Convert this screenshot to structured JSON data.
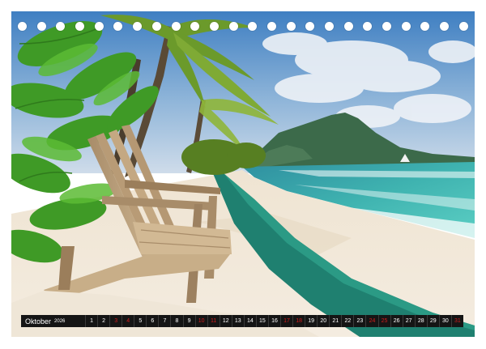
{
  "calendar": {
    "month": "Oktober",
    "year": "2026",
    "days": [
      {
        "label": "1",
        "weekend": false
      },
      {
        "label": "2",
        "weekend": false
      },
      {
        "label": "3",
        "weekend": true
      },
      {
        "label": "4",
        "weekend": true
      },
      {
        "label": "5",
        "weekend": false
      },
      {
        "label": "6",
        "weekend": false
      },
      {
        "label": "7",
        "weekend": false
      },
      {
        "label": "8",
        "weekend": false
      },
      {
        "label": "9",
        "weekend": false
      },
      {
        "label": "10",
        "weekend": true
      },
      {
        "label": "11",
        "weekend": true
      },
      {
        "label": "12",
        "weekend": false
      },
      {
        "label": "13",
        "weekend": false
      },
      {
        "label": "14",
        "weekend": false
      },
      {
        "label": "15",
        "weekend": false
      },
      {
        "label": "16",
        "weekend": false
      },
      {
        "label": "17",
        "weekend": true
      },
      {
        "label": "18",
        "weekend": true
      },
      {
        "label": "19",
        "weekend": false
      },
      {
        "label": "20",
        "weekend": false
      },
      {
        "label": "21",
        "weekend": false
      },
      {
        "label": "22",
        "weekend": false
      },
      {
        "label": "23",
        "weekend": false
      },
      {
        "label": "24",
        "weekend": true
      },
      {
        "label": "25",
        "weekend": true
      },
      {
        "label": "26",
        "weekend": false
      },
      {
        "label": "27",
        "weekend": false
      },
      {
        "label": "28",
        "weekend": false
      },
      {
        "label": "29",
        "weekend": false
      },
      {
        "label": "30",
        "weekend": false
      },
      {
        "label": "31",
        "weekend": true
      }
    ]
  },
  "binding": {
    "hole_count": 24
  },
  "colors": {
    "bar_background": "#151515",
    "weekend_text": "#d21d1d",
    "weekday_text": "#ffffff"
  }
}
